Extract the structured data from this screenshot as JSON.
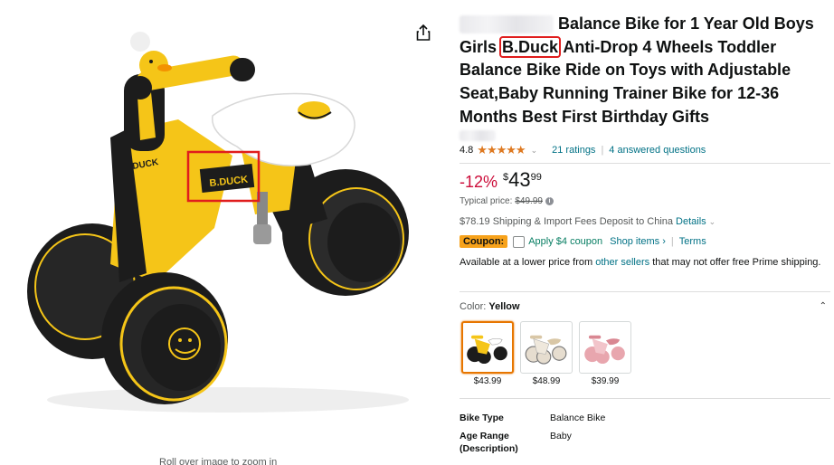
{
  "gallery": {
    "zoom_hint": "Roll over image to zoom in",
    "share_icon": "share-icon"
  },
  "product": {
    "title_before_brand": "Balance Bike for 1 Year Old Boys Girls",
    "brand": "B.Duck",
    "title_after_brand": "Anti-Drop 4 Wheels Toddler Balance Bike Ride on Toys with Adjustable Seat,Baby Running Trainer Bike for 12-36 Months Best First Birthday Gifts",
    "seat_logo": "B.DUCK",
    "frame_label": "B.DUCK"
  },
  "rating": {
    "value": "4.8",
    "stars": "★★★★★",
    "ratings_link": "21 ratings",
    "questions_link": "4 answered questions"
  },
  "price": {
    "discount": "-12%",
    "symbol": "$",
    "whole": "43",
    "fraction": "99",
    "typical_label": "Typical price:",
    "typical_value": "$49.99"
  },
  "shipping": {
    "text": "$78.19 Shipping & Import Fees Deposit to China",
    "details_link": "Details"
  },
  "coupon": {
    "badge": "Coupon:",
    "apply_label": "Apply $4 coupon",
    "shop_items": "Shop items ›",
    "terms": "Terms"
  },
  "availability": {
    "prefix": "Available at a lower price from",
    "link": "other sellers",
    "suffix": "that may not offer free Prime shipping."
  },
  "color": {
    "label": "Color:",
    "selected": "Yellow",
    "options": [
      {
        "name": "Yellow",
        "price": "$43.99"
      },
      {
        "name": "Beige",
        "price": "$48.99"
      },
      {
        "name": "Pink",
        "price": "$39.99"
      }
    ]
  },
  "specs": [
    {
      "key": "Bike Type",
      "value": "Balance Bike"
    },
    {
      "key": "Age Range (Description)",
      "value": "Baby"
    }
  ],
  "colors": {
    "price_red": "#cc0c39",
    "link_teal": "#007185",
    "star_orange": "#de7921",
    "coupon_orange": "#f7a21b",
    "highlight_red": "#e01d1d",
    "bike_yellow": "#f5c518",
    "bike_black": "#1c1c1c"
  }
}
